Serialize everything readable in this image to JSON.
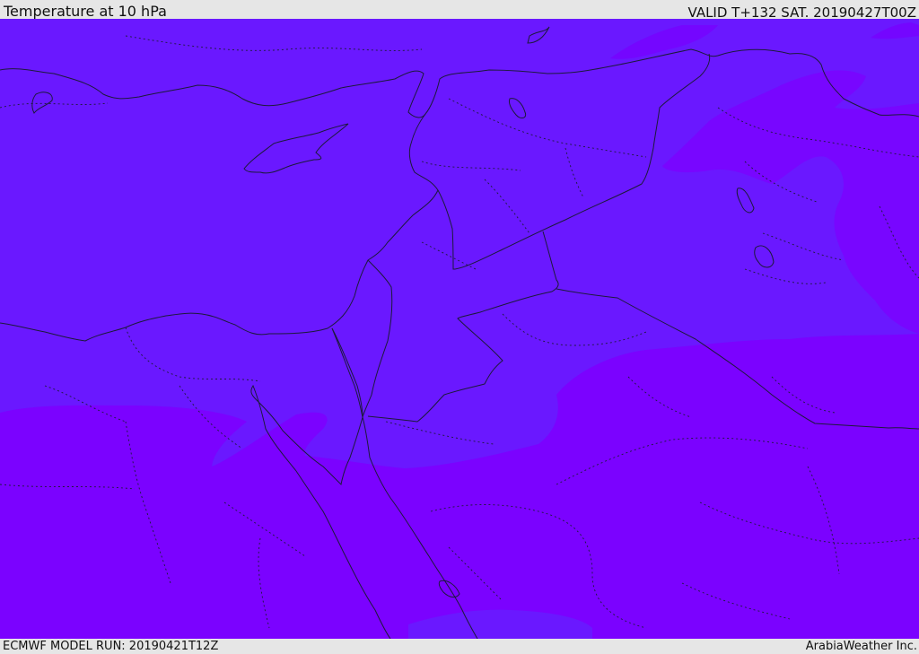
{
  "header": {
    "title": "Temperature at 10 hPa",
    "valid_time": "VALID T+132 SAT. 20190427T00Z"
  },
  "footer": {
    "model_run": "ECMWF MODEL RUN: 20190421T12Z",
    "credit": "ArabiaWeather Inc."
  },
  "map": {
    "region": "Eastern Mediterranean / Levant / Egypt / Iraq",
    "colors": {
      "warmer_fill": "#6a18ff",
      "mid_fill": "#6e14ff",
      "cooler_fill": "#7c00ff",
      "coastline": "#1a1a40",
      "border": "#1a1a40"
    }
  }
}
